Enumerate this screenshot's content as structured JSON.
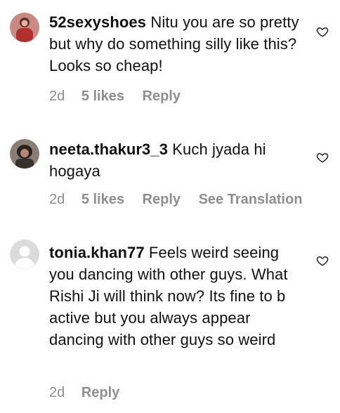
{
  "comments": [
    {
      "username": "52sexyshoes",
      "text": "Nitu you are so pretty  but why do something silly like this? Looks so cheap!",
      "time": "2d",
      "likes": "5 likes",
      "reply": "Reply",
      "translation": ""
    },
    {
      "username": "neeta.thakur3_3",
      "text": "Kuch jyada hi hogaya",
      "time": "2d",
      "likes": "5 likes",
      "reply": "Reply",
      "translation": "See Translation"
    },
    {
      "username": "tonia.khan77",
      "text": "Feels weird seeing you dancing with other guys. What Rishi Ji will think now? Its fine to b active but you always appear dancing with other guys so weird",
      "time": "2d",
      "likes": "",
      "reply": "Reply",
      "translation": ""
    }
  ],
  "icons": {
    "like": "heart-outline-icon",
    "avatar_placeholder": "default-avatar-icon"
  },
  "colors": {
    "meta_text": "#8e8e8e",
    "text": "#111111",
    "placeholder_avatar": "#d9d9d9"
  }
}
